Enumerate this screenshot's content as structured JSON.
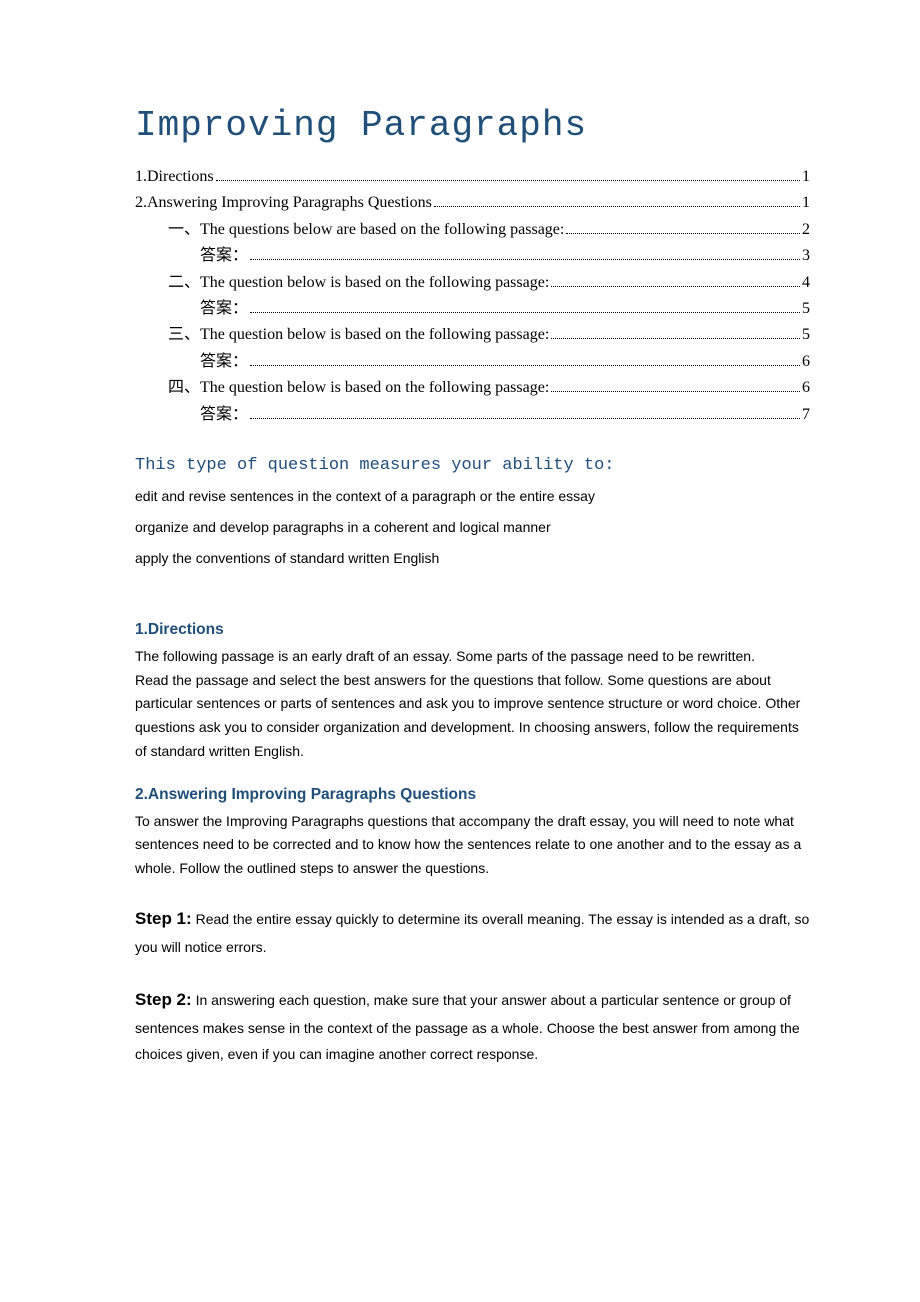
{
  "title": "Improving Paragraphs",
  "toc": [
    {
      "level": 1,
      "label": "1.Directions",
      "page": "1"
    },
    {
      "level": 1,
      "label": "2.Answering Improving Paragraphs Questions ",
      "page": "1"
    },
    {
      "level": 2,
      "label": "一、The questions below are based on the following passage: ",
      "page": "2"
    },
    {
      "level": 3,
      "label": "答案：",
      "page": "3"
    },
    {
      "level": 2,
      "label": "二、The question below is based on the following passage: ",
      "page": "4"
    },
    {
      "level": 3,
      "label": "答案：",
      "page": "5"
    },
    {
      "level": 2,
      "label": "三、The question below is based on the following passage: ",
      "page": "5"
    },
    {
      "level": 3,
      "label": "答案：",
      "page": "6"
    },
    {
      "level": 2,
      "label": "四、The question below is based on the following passage: ",
      "page": "6"
    },
    {
      "level": 3,
      "label": "答案：",
      "page": "7"
    }
  ],
  "ability_heading": "This type of question measures your ability to:",
  "abilities": [
    "edit and revise sentences in the context of a paragraph or the entire essay",
    "organize and develop paragraphs in a coherent and logical manner",
    "apply the conventions of standard written English"
  ],
  "section1": {
    "heading": "1.Directions",
    "p1": "The following passage is an early draft of an essay. Some parts of the passage need to be rewritten.",
    "p2": "Read the passage and select the best answers for the questions that follow. Some questions are about particular sentences or parts of sentences and ask you to improve sentence structure or word choice. Other questions ask you to consider organization and development. In choosing answers, follow the requirements of standard written English."
  },
  "section2": {
    "heading": "2.Answering Improving Paragraphs Questions",
    "intro": "To answer the Improving Paragraphs questions that accompany the draft essay, you will need to note what sentences need to be corrected and to know how the sentences relate to one another and to the essay as a whole. Follow the outlined steps to answer the questions.",
    "step1_label": "Step 1:",
    "step1_text": " Read the entire essay quickly to determine its overall meaning. The essay is intended as a draft, so you will notice errors.",
    "step2_label": "Step 2:",
    "step2_text": " In answering each question, make sure that your answer about a particular sentence or group of sentences makes sense in the context of the passage as a whole. Choose the best answer from among the choices given, even if you can imagine another correct response."
  }
}
